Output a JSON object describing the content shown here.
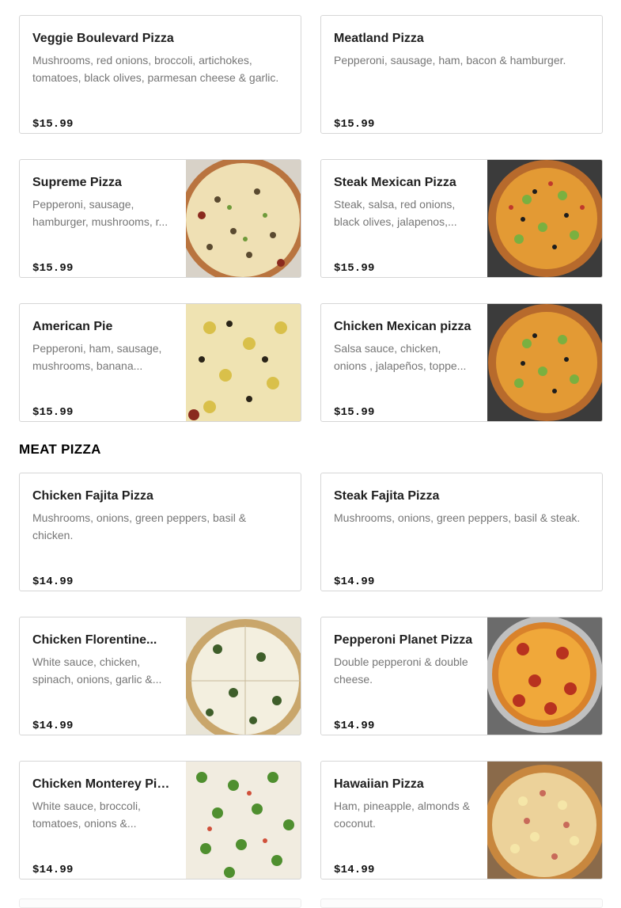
{
  "top_items": [
    {
      "name": "Veggie Boulevard Pizza",
      "desc": "Mushrooms, red onions, broccoli, artichokes, tomatoes, black olives, parmesan cheese & garlic.",
      "price": "$15.99",
      "image": null
    },
    {
      "name": "Meatland Pizza",
      "desc": "Pepperoni, sausage, ham, bacon & hamburger.",
      "price": "$15.99",
      "image": null
    },
    {
      "name": "Supreme Pizza",
      "desc": "Pepperoni, sausage, hamburger, mushrooms, r...",
      "price": "$15.99",
      "image": "supreme"
    },
    {
      "name": "Steak Mexican Pizza",
      "desc": "Steak, salsa, red onions, black olives, jalapenos,...",
      "price": "$15.99",
      "image": "mexican"
    },
    {
      "name": "American Pie",
      "desc": "Pepperoni, ham, sausage, mushrooms, banana...",
      "price": "$15.99",
      "image": "american"
    },
    {
      "name": "Chicken Mexican pizza",
      "desc": "Salsa sauce, chicken, onions , jalapeños, toppe...",
      "price": "$15.99",
      "image": "mexican"
    }
  ],
  "meat_section": {
    "title": "MEAT PIZZA",
    "items": [
      {
        "name": "Chicken Fajita Pizza",
        "desc": "Mushrooms, onions, green peppers, basil & chicken.",
        "price": "$14.99",
        "image": null
      },
      {
        "name": "Steak Fajita Pizza",
        "desc": "Mushrooms, onions, green peppers, basil & steak.",
        "price": "$14.99",
        "image": null
      },
      {
        "name": "Chicken Florentine...",
        "desc": "White sauce, chicken, spinach, onions, garlic &...",
        "price": "$14.99",
        "image": "florentine"
      },
      {
        "name": "Pepperoni Planet Pizza",
        "desc": "Double pepperoni & double cheese.",
        "price": "$14.99",
        "image": "pepperoni"
      },
      {
        "name": "Chicken Monterey Pizza",
        "desc": "White sauce, broccoli, tomatoes, onions &...",
        "price": "$14.99",
        "image": "monterey"
      },
      {
        "name": "Hawaiian Pizza",
        "desc": "Ham, pineapple, almonds & coconut.",
        "price": "$14.99",
        "image": "hawaiian"
      }
    ]
  }
}
